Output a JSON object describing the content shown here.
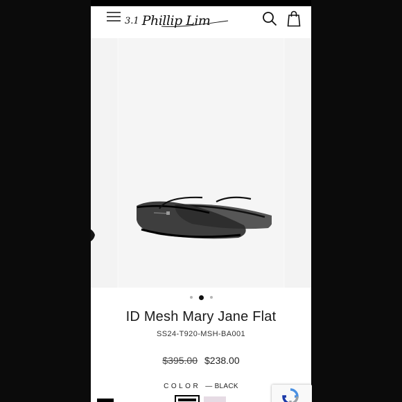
{
  "header": {
    "logo_prefix": "3.1",
    "logo_text": "Phillip Lim"
  },
  "product": {
    "title": "ID Mesh Mary Jane Flat",
    "sku": "SS24-T920-MSH-BA001",
    "price_original": "$395.00",
    "price_sale": "$238.00",
    "color_label": "COLOR",
    "color_value": "— BLACK"
  },
  "gallery": {
    "slide_count": 3,
    "active_index": 1
  },
  "swatches": [
    {
      "name": "black",
      "color": "#000000",
      "selected": true
    },
    {
      "name": "pink",
      "color": "#e6dbe4",
      "selected": false
    }
  ],
  "icons": {
    "menu": "hamburger-icon",
    "search": "search-icon",
    "bag": "shopping-bag-icon",
    "zoom": "zoom-icon",
    "recaptcha": "recaptcha-icon"
  }
}
